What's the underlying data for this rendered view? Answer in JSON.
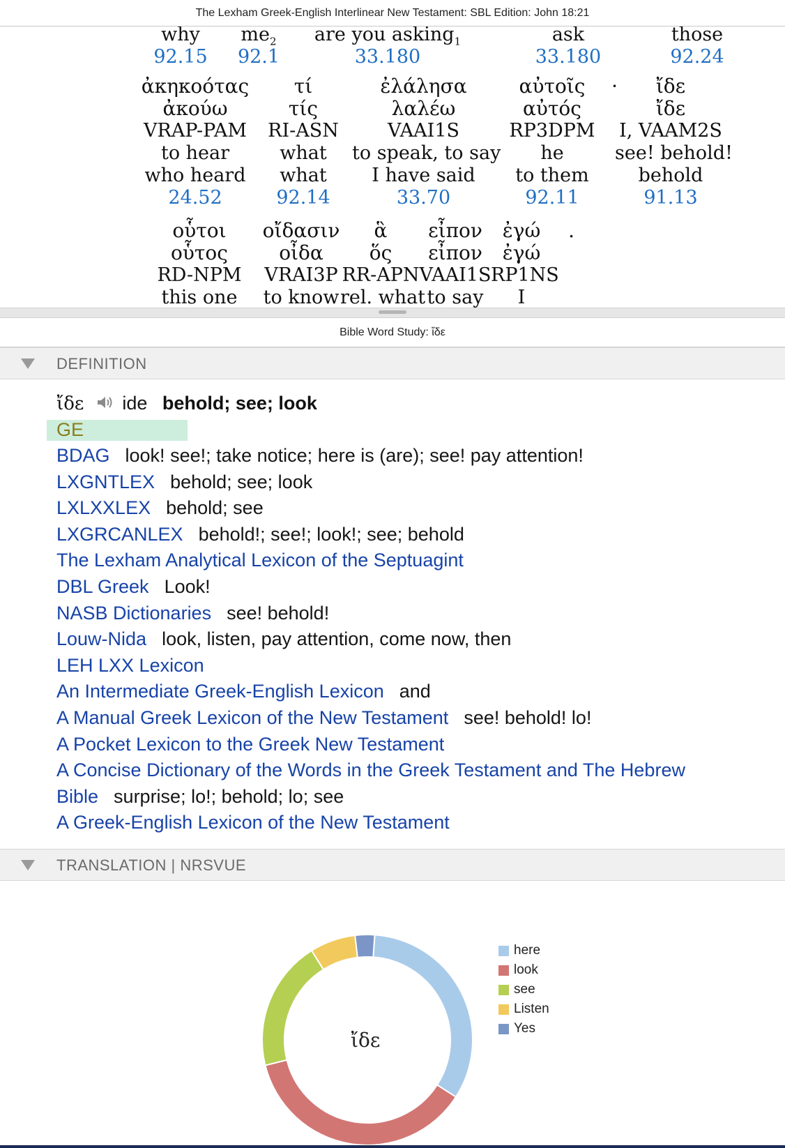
{
  "top_pane": {
    "title": "The Lexham Greek-English Interlinear New Testament: SBL Edition: John 18:21",
    "row0": [
      {
        "eng": "why",
        "num": "92.15"
      },
      {
        "eng": "me",
        "sub": "2",
        "num": "92.1"
      },
      {
        "eng": "are you asking",
        "sub": "1",
        "num": "33.180"
      },
      {
        "eng": "ask",
        "num": "33.180"
      },
      {
        "eng": "those",
        "num": "92.24"
      }
    ],
    "row1": [
      {
        "surface": "ἀκηκοότας",
        "lemma": "ἀκούω",
        "morph": "VRAP-PAM",
        "gloss": "to hear",
        "trans": "who heard",
        "ln": "24.52"
      },
      {
        "surface": "τί",
        "lemma": "τίς",
        "morph": "RI-ASN",
        "gloss": "what",
        "trans": "what",
        "ln": "92.14"
      },
      {
        "surface": "ἐλάλησα",
        "lemma": "λαλέω",
        "morph": "VAAI1S",
        "gloss": "to speak, to say",
        "trans": "I have said",
        "ln": "33.70"
      },
      {
        "surface": "αὐτοῖς",
        "punct": "·",
        "lemma": "αὐτός",
        "morph": "RP3DPM",
        "gloss": "he",
        "trans": "to them",
        "ln": "92.11"
      },
      {
        "surface": "ἴδε",
        "lemma": "ἴδε",
        "morph": "I, VAAM2S",
        "gloss": "see! behold!",
        "trans": "behold",
        "ln": "91.13"
      }
    ],
    "row2": [
      {
        "surface": "οὗτοι",
        "lemma": "οὗτος",
        "morph": "RD-NPM",
        "gloss": "this one"
      },
      {
        "surface": "οἴδασιν",
        "lemma": "οἶδα",
        "morph": "VRAI3P",
        "gloss": "to know"
      },
      {
        "surface": "ἃ",
        "lemma": "ὅς",
        "morph": "RR-APN",
        "gloss": "rel. what"
      },
      {
        "surface": "εἶπον",
        "lemma": "εἶπον",
        "morph": "VAAI1S",
        "gloss": "to say"
      },
      {
        "surface": "ἐγώ",
        "punct": ".",
        "lemma": "ἐγώ",
        "morph": "RP1NS",
        "gloss": "I"
      }
    ]
  },
  "study": {
    "title": "Bible Word Study: ἴδε",
    "definition_header": "DEFINITION",
    "translation_header": "TRANSLATION | NRSVUE",
    "headword": {
      "greek": "ἴδε",
      "translit": "ide",
      "gloss": "behold; see; look"
    },
    "ge_label": "GE",
    "entries": [
      {
        "source": "BDAG",
        "gloss": "look! see!; take notice; here is (are); see! pay attention!"
      },
      {
        "source": "LXGNTLEX",
        "gloss": "behold; see; look"
      },
      {
        "source": "LXLXXLEX",
        "gloss": "behold; see"
      },
      {
        "source": "LXGRCANLEX",
        "gloss": "behold!; see!; look!; see; behold"
      },
      {
        "source": "The Lexham Analytical Lexicon of the Septuagint",
        "gloss": ""
      },
      {
        "source": "DBL Greek",
        "gloss": "Look!"
      },
      {
        "source": "NASB Dictionaries",
        "gloss": "see! behold!"
      },
      {
        "source": "Louw-Nida",
        "gloss": "look, listen, pay attention, come now, then"
      },
      {
        "source": "LEH LXX Lexicon",
        "gloss": ""
      },
      {
        "source": "An Intermediate Greek-English Lexicon",
        "gloss": "and"
      },
      {
        "source": "A Manual Greek Lexicon of the New Testament",
        "gloss": "see! behold! lo!"
      },
      {
        "source": "A Pocket Lexicon to the Greek New Testament",
        "gloss": ""
      },
      {
        "source": "A Concise Dictionary of the Words in the Greek Testament and The Hebrew",
        "gloss": ""
      },
      {
        "source": "Bible",
        "gloss": "surprise; lo!; behold; lo; see"
      },
      {
        "source": "A Greek-English Lexicon of the New Testament",
        "gloss": ""
      }
    ]
  },
  "chart_data": {
    "type": "pie",
    "center_label": "ἴδε",
    "legend_position": "right",
    "categories": [
      "here",
      "look",
      "see",
      "Listen",
      "Yes"
    ],
    "values": [
      33,
      37,
      20,
      7,
      3
    ],
    "colors": [
      "#a9cbea",
      "#d27674",
      "#b5cf52",
      "#f2c95c",
      "#7b95c6"
    ]
  }
}
